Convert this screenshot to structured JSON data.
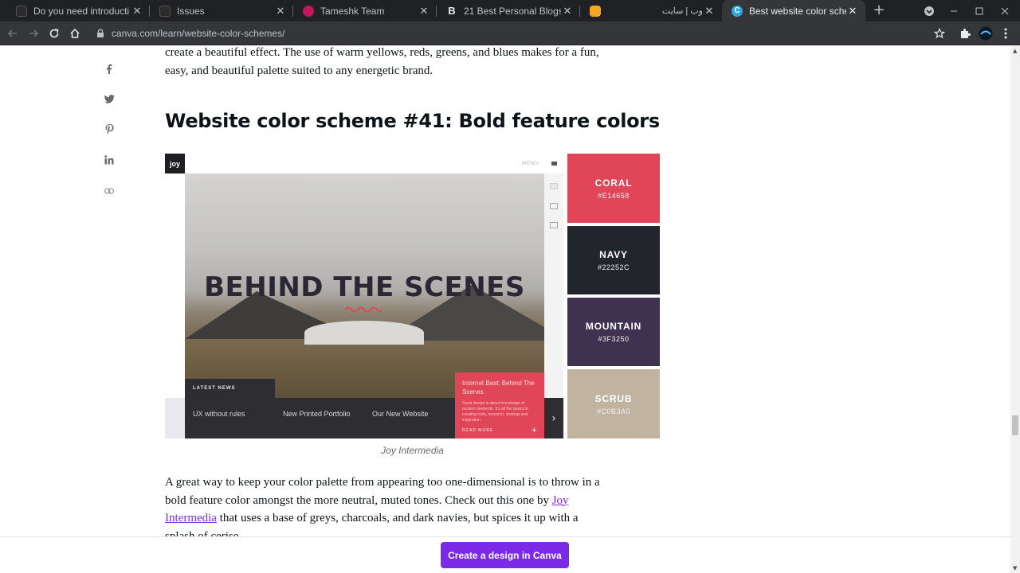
{
  "browser": {
    "tabs": [
      {
        "title": "Do you need introducti",
        "favicon": "github-icon"
      },
      {
        "title": "Issues",
        "favicon": "github-icon"
      },
      {
        "title": "Tameshk Team",
        "favicon": "tameshk-icon"
      },
      {
        "title": "21 Best Personal Blogs",
        "favicon": "b-letter-icon",
        "favicon_text": "B"
      },
      {
        "title": "",
        "favicon": "orange-app-icon"
      },
      {
        "title": "وب | سایت",
        "favicon": "none"
      },
      {
        "title": "Best website color sche",
        "favicon": "canva-icon",
        "favicon_text": "C",
        "active": true
      }
    ],
    "close_glyph": "✕",
    "new_tab_glyph": "+",
    "address": "canva.com/learn/website-color-schemes/",
    "accent": "#7d2ae8"
  },
  "article": {
    "intro_lines": [
      "create a beautiful effect. The use of warm yellows, reds, greens, and blues makes for a fun,",
      "easy, and beautiful palette suited to any energetic brand."
    ],
    "heading": "Website color scheme #41: Bold feature colors",
    "caption": "Joy Intermedia",
    "body": {
      "line1": "A great way to keep your color palette from appearing too one-dimensional is to throw in a",
      "line2_pre": "bold feature color amongst the more neutral, muted tones. Check out this one by ",
      "link_part1": "Joy",
      "link_part2": "Intermedia",
      "line3_post": " that uses a base of greys, charcoals, and dark navies, but spices it up with a",
      "line4": "splash of cerise."
    }
  },
  "share": {
    "facebook": "f",
    "twitter": "t",
    "pinterest": "p",
    "linkedin": "in",
    "link": "link"
  },
  "feature_image": {
    "logo": "joy",
    "menu": "MENU",
    "hero_text": "BEHIND THE SCENES",
    "latest_news": "LATEST NEWS",
    "news_links": [
      "UX without rules",
      "New Printed Portfolio",
      "Our New Website"
    ],
    "card_title": "Internet Best: Behind The Scenes",
    "card_body": "Good design is about knowledge of modern elements. It's all the basics in creating tools, research, strategy and inspiration",
    "card_footer": "READ MORE",
    "card_plus": "+",
    "next_arrow": "›",
    "palette": [
      {
        "name": "CORAL",
        "hex": "#E14658",
        "color": "#e14658"
      },
      {
        "name": "NAVY",
        "hex": "#22252C",
        "color": "#22252c"
      },
      {
        "name": "MOUNTAIN",
        "hex": "#3F3250",
        "color": "#3f3250"
      },
      {
        "name": "SCRUB",
        "hex": "#C0B3A0",
        "color": "#c0b3a0"
      }
    ]
  },
  "cta": {
    "label": "Create a design in Canva"
  }
}
